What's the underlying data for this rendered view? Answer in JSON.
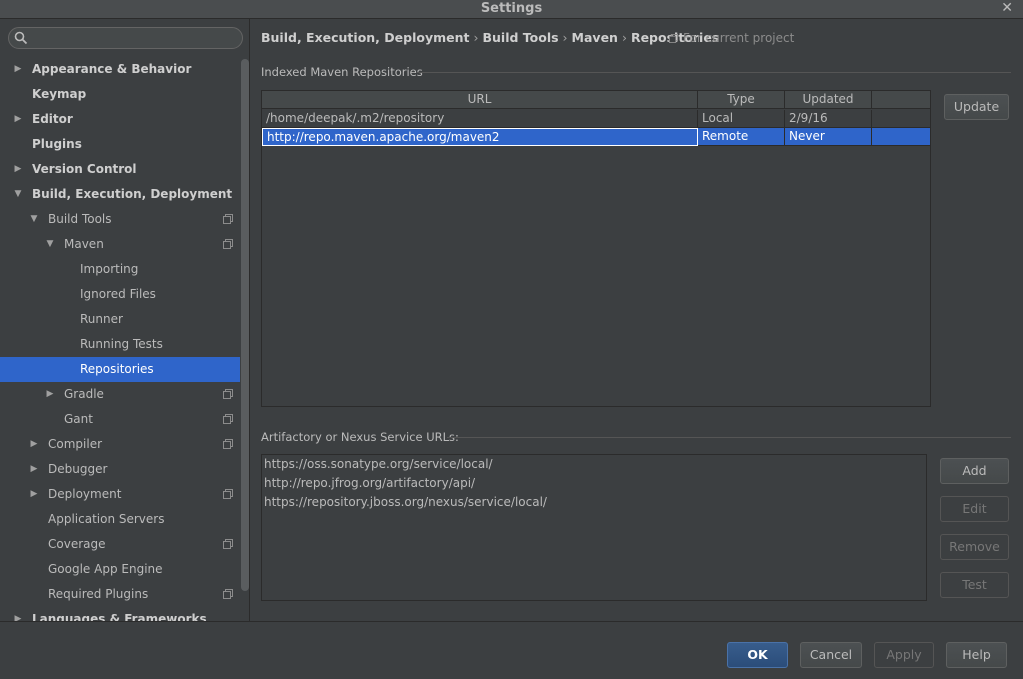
{
  "window": {
    "title": "Settings",
    "close_glyph": "✕"
  },
  "search": {
    "placeholder": "",
    "value": ""
  },
  "sidebar": {
    "items": [
      {
        "label": "Appearance & Behavior",
        "arrow": "▶",
        "bold": true
      },
      {
        "label": "Keymap",
        "bold": true
      },
      {
        "label": "Editor",
        "arrow": "▶",
        "bold": true
      },
      {
        "label": "Plugins",
        "bold": true
      },
      {
        "label": "Version Control",
        "arrow": "▶",
        "bold": true
      },
      {
        "label": "Build, Execution, Deployment",
        "arrow": "▼",
        "bold": true
      },
      {
        "label": "Build Tools",
        "arrow": "▼",
        "project_icon": true
      },
      {
        "label": "Maven",
        "arrow": "▼",
        "project_icon": true
      },
      {
        "label": "Importing"
      },
      {
        "label": "Ignored Files"
      },
      {
        "label": "Runner"
      },
      {
        "label": "Running Tests"
      },
      {
        "label": "Repositories",
        "selected": true
      },
      {
        "label": "Gradle",
        "arrow": "▶",
        "project_icon": true
      },
      {
        "label": "Gant",
        "project_icon": true
      },
      {
        "label": "Compiler",
        "arrow": "▶",
        "project_icon": true
      },
      {
        "label": "Debugger",
        "arrow": "▶"
      },
      {
        "label": "Deployment",
        "arrow": "▶",
        "project_icon": true
      },
      {
        "label": "Application Servers"
      },
      {
        "label": "Coverage",
        "project_icon": true
      },
      {
        "label": "Google App Engine"
      },
      {
        "label": "Required Plugins",
        "project_icon": true
      },
      {
        "label": "Languages & Frameworks",
        "arrow": "▶",
        "bold": true
      }
    ]
  },
  "breadcrumb": {
    "parts": [
      "Build, Execution, Deployment",
      "Build Tools",
      "Maven",
      "Repositories"
    ],
    "separator": "›",
    "scope": "For current project"
  },
  "indexed": {
    "title": "Indexed Maven Repositories",
    "columns": [
      "URL",
      "Type",
      "Updated"
    ],
    "rows": [
      {
        "url": "/home/deepak/.m2/repository",
        "type": "Local",
        "updated": "2/9/16"
      },
      {
        "url": "http://repo.maven.apache.org/maven2",
        "type": "Remote",
        "updated": "Never",
        "selected": true
      }
    ],
    "update_label": "Update"
  },
  "artifactory": {
    "title": "Artifactory or Nexus Service URLs:",
    "urls": [
      "https://oss.sonatype.org/service/local/",
      "http://repo.jfrog.org/artifactory/api/",
      "https://repository.jboss.org/nexus/service/local/"
    ],
    "add_label": "Add",
    "edit_label": "Edit",
    "remove_label": "Remove",
    "test_label": "Test"
  },
  "footer": {
    "ok_label": "OK",
    "cancel_label": "Cancel",
    "apply_label": "Apply",
    "help_label": "Help"
  },
  "colors": {
    "selection": "#2f65ca",
    "background": "#3c3f41",
    "text": "#bbbbbb"
  }
}
